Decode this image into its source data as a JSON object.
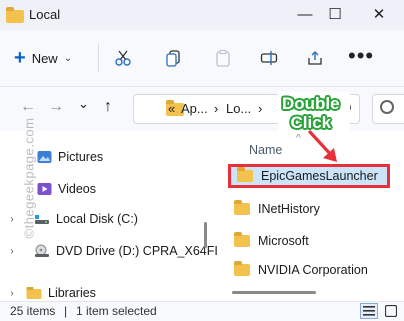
{
  "window": {
    "title": "Local",
    "controls": {
      "minimize": "—",
      "maximize": "☐",
      "close": "✕"
    }
  },
  "toolbar": {
    "new_label": "New",
    "new_plus": "+",
    "new_chevron": "⌄",
    "more_label": "•••"
  },
  "address": {
    "back": "←",
    "forward": "→",
    "recent": "⌄",
    "up": "↑",
    "lead": "«",
    "crumbs": [
      "Ap...",
      "Lo..."
    ],
    "separator": "›",
    "refresh": "↻"
  },
  "navigation": {
    "items": [
      {
        "label": "Pictures",
        "icon": "pictures-icon",
        "expand": ""
      },
      {
        "label": "Videos",
        "icon": "videos-icon",
        "expand": ""
      },
      {
        "label": "Local Disk (C:)",
        "icon": "drive-icon",
        "expand": "›"
      },
      {
        "label": "DVD Drive (D:) CPRA_X64FI",
        "icon": "dvd-icon",
        "expand": "›"
      },
      {
        "label": "Libraries",
        "icon": "libraries-icon",
        "expand": "›"
      }
    ]
  },
  "filelist": {
    "column_name": "Name",
    "sort_indicator": "^",
    "rows": [
      {
        "name": "EpicGamesLauncher",
        "selected": true
      },
      {
        "name": "INetHistory",
        "selected": false
      },
      {
        "name": "Microsoft",
        "selected": false
      },
      {
        "name": "NVIDIA Corporation",
        "selected": false
      }
    ]
  },
  "annotation": {
    "line1": "Double",
    "line2": "Click",
    "color": "#2aa33a",
    "arrow_color": "#e8303a"
  },
  "watermark": "©thegeekpage.com",
  "status": {
    "item_count": "25 items",
    "selection": "1 item selected"
  },
  "colors": {
    "selection_bg": "#cce4f7",
    "highlight_border": "#e8303a",
    "folder": "#f2c24d",
    "accent": "#0a64c8"
  }
}
